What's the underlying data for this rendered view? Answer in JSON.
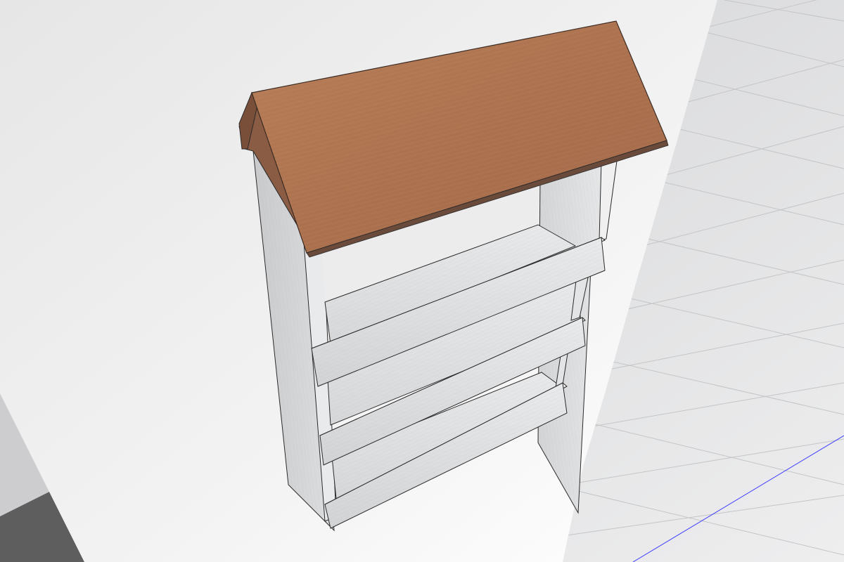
{
  "scene": {
    "object": "wall-mounted-shelf",
    "shelf_count": 3,
    "roof_material": "wood-walnut",
    "frame_material": "wood-white"
  },
  "colors": {
    "ground": "#d6d7d9",
    "ground_near": "#eceded",
    "grid_line": "#c4c5c8",
    "axis": "#3b3bff",
    "wall": "#ececec",
    "wall_shade": "#e2e2e2",
    "floor_dark": "#5e5e5e",
    "roof_top": "#b0754f",
    "roof_top_dark": "#9c6443",
    "roof_edge": "#6a4a3a",
    "frame_light": "#e4e5e6",
    "frame_mid": "#cfd0d2",
    "frame_dark": "#b3b4b6",
    "outline": "#2a2a2a"
  }
}
